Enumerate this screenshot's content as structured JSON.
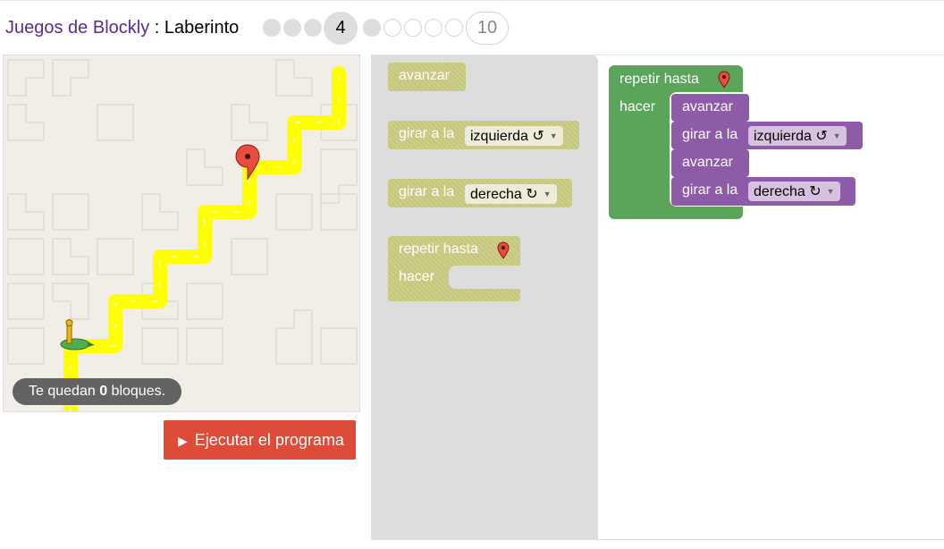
{
  "header": {
    "app_link": "Juegos de Blockly",
    "separator": " : ",
    "game_name": "Laberinto",
    "current_level": "4",
    "last_level": "10"
  },
  "maze": {
    "capacity_prefix": "Te quedan ",
    "capacity_count": "0",
    "capacity_suffix": " bloques."
  },
  "run_button": {
    "label": "Ejecutar el programa",
    "icon": "play-icon"
  },
  "toolbox": {
    "move_forward": "avanzar",
    "turn_left_label": "girar a la",
    "turn_left_value": "izquierda ↺",
    "turn_right_label": "girar a la",
    "turn_right_value": "derecha ↻",
    "repeat_label": "repetir hasta",
    "do_label": "hacer"
  },
  "workspace": {
    "repeat_label": "repetir hasta",
    "do_label": "hacer",
    "stmt1": "avanzar",
    "stmt2_label": "girar a la",
    "stmt2_value": "izquierda ↺",
    "stmt3": "avanzar",
    "stmt4_label": "girar a la",
    "stmt4_value": "derecha ↻"
  },
  "colors": {
    "link": "#5b2d8e",
    "run_button": "#dd4b39",
    "loop_block": "#5ba55b",
    "action_block": "#8e5ba8",
    "path": "#ffff00"
  }
}
